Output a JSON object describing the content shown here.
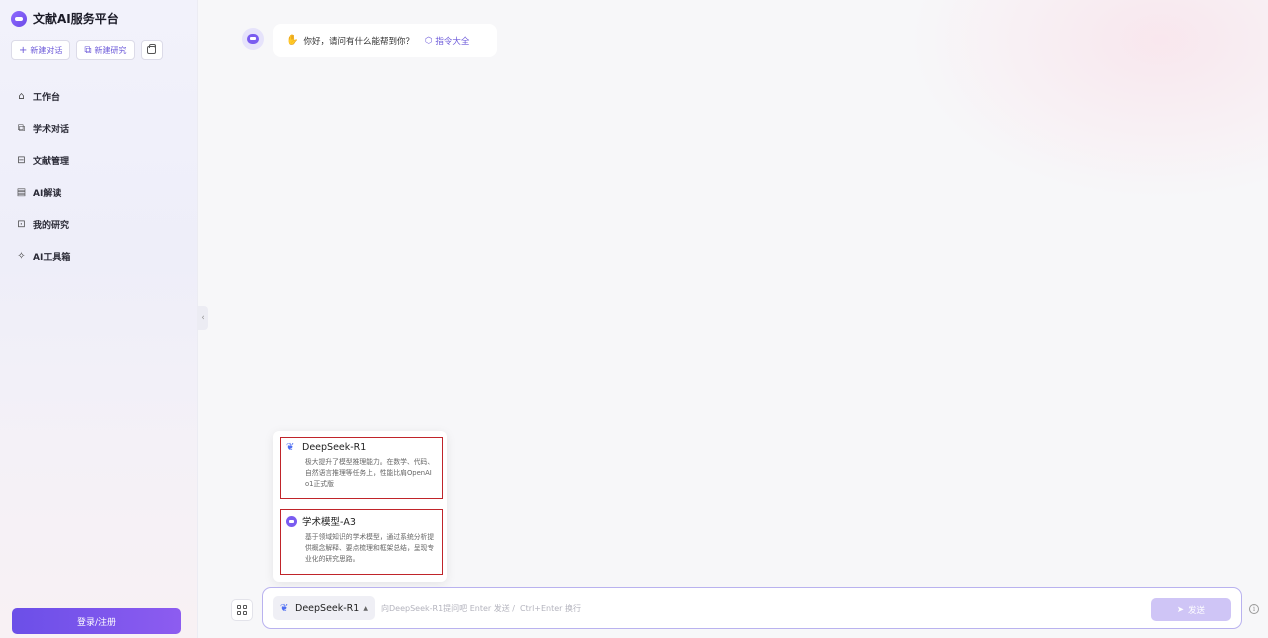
{
  "brand": {
    "title": "文献AI服务平台"
  },
  "sidebar": {
    "new_chat": "新建对话",
    "new_research": "新建研究",
    "items": [
      {
        "label": "工作台",
        "icon": "home-icon"
      },
      {
        "label": "学术对话",
        "icon": "chat-icon"
      },
      {
        "label": "文献管理",
        "icon": "library-icon"
      },
      {
        "label": "AI解读",
        "icon": "document-icon"
      },
      {
        "label": "我的研究",
        "icon": "research-icon"
      },
      {
        "label": "AI工具箱",
        "icon": "toolbox-icon"
      }
    ],
    "login": "登录/注册"
  },
  "chat": {
    "greeting": "你好，请问有什么能帮到你？",
    "commands_link": "指令大全"
  },
  "model_menu": {
    "options": [
      {
        "name": "DeepSeek-R1",
        "desc": "极大提升了模型推理能力。在数学、代码、自然语言推理等任务上，性能比肩OpenAI o1正式版"
      },
      {
        "name": "学术模型-A3",
        "desc": "基于领域知识的学术模型，通过系统分析提供概念解释、要点梳理和框架总结，呈现专业化的研究思路。"
      }
    ]
  },
  "input": {
    "selected_model": "DeepSeek-R1",
    "placeholder": "向DeepSeek-R1提问吧 Enter 发送 /  Ctrl+Enter 换行",
    "value": "",
    "send": "发送"
  },
  "colors": {
    "accent": "#6b58d9",
    "send_disabled": "#cfc5f6",
    "highlight_border": "#c0242a"
  }
}
